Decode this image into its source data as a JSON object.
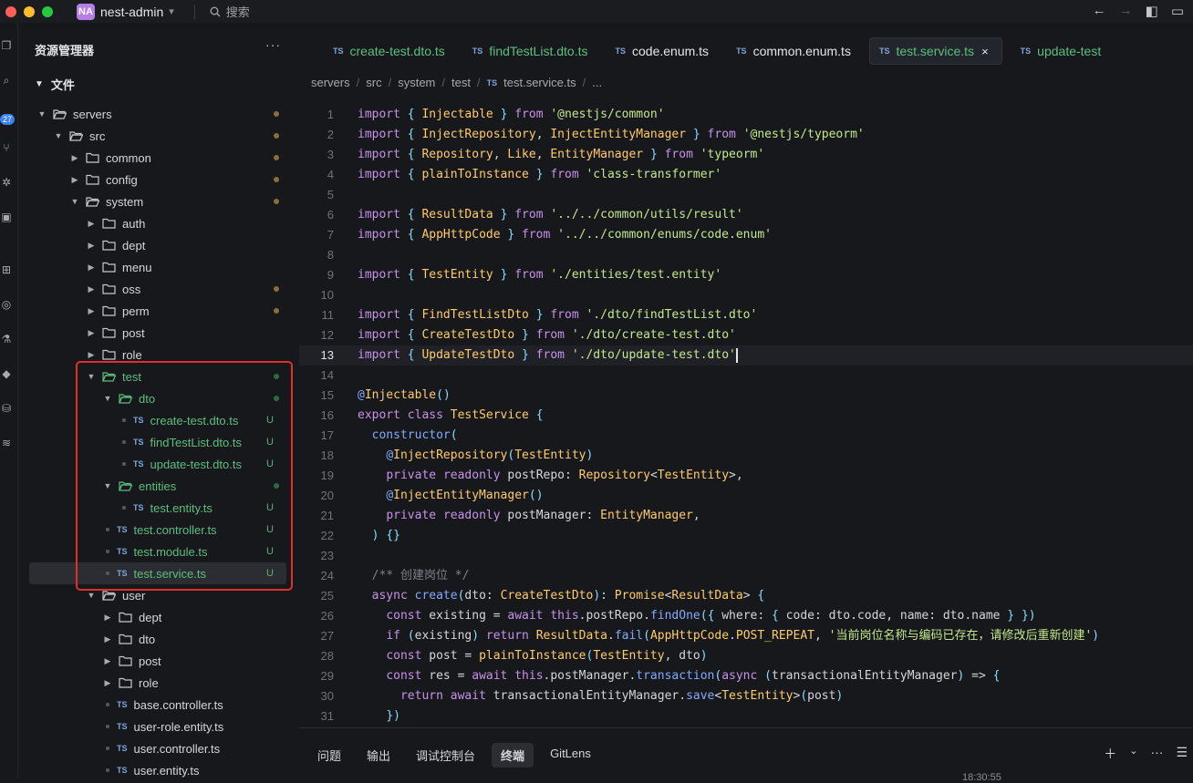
{
  "titlebar": {
    "workspace_badge": "NA",
    "workspace_name": "nest-admin",
    "search_label": "搜索"
  },
  "activity": {
    "badge_count": "27"
  },
  "explorer": {
    "title": "资源管理器",
    "more": "···",
    "section": "文件",
    "items": [
      {
        "label": "servers",
        "kind": "folder",
        "depth": 0,
        "open": true,
        "color": "folder",
        "status": "dot-modified"
      },
      {
        "label": "src",
        "kind": "folder",
        "depth": 1,
        "open": true,
        "color": "folder",
        "status": "dot-modified"
      },
      {
        "label": "common",
        "kind": "folder",
        "depth": 2,
        "open": false,
        "status": "dot-modified"
      },
      {
        "label": "config",
        "kind": "folder",
        "depth": 2,
        "open": false,
        "status": "dot-modified"
      },
      {
        "label": "system",
        "kind": "folder",
        "depth": 2,
        "open": true,
        "status": "dot-modified"
      },
      {
        "label": "auth",
        "kind": "folder",
        "depth": 3,
        "open": false
      },
      {
        "label": "dept",
        "kind": "folder",
        "depth": 3,
        "open": false
      },
      {
        "label": "menu",
        "kind": "folder",
        "depth": 3,
        "open": false
      },
      {
        "label": "oss",
        "kind": "folder",
        "depth": 3,
        "open": false,
        "status": "dot-modified"
      },
      {
        "label": "perm",
        "kind": "folder",
        "depth": 3,
        "open": false,
        "status": "dot-modified"
      },
      {
        "label": "post",
        "kind": "folder",
        "depth": 3,
        "open": false
      },
      {
        "label": "role",
        "kind": "folder",
        "depth": 3,
        "open": false
      },
      {
        "label": "test",
        "kind": "folder",
        "depth": 3,
        "open": true,
        "green": true,
        "status": "dot-new"
      },
      {
        "label": "dto",
        "kind": "folder",
        "depth": 4,
        "open": true,
        "green": true,
        "status": "dot-new"
      },
      {
        "label": "create-test.dto.ts",
        "kind": "ts",
        "depth": 5,
        "green": true,
        "status": "U"
      },
      {
        "label": "findTestList.dto.ts",
        "kind": "ts",
        "depth": 5,
        "green": true,
        "status": "U"
      },
      {
        "label": "update-test.dto.ts",
        "kind": "ts",
        "depth": 5,
        "green": true,
        "status": "U"
      },
      {
        "label": "entities",
        "kind": "folder",
        "depth": 4,
        "open": true,
        "green": true,
        "status": "dot-new"
      },
      {
        "label": "test.entity.ts",
        "kind": "ts",
        "depth": 5,
        "green": true,
        "status": "U"
      },
      {
        "label": "test.controller.ts",
        "kind": "ts",
        "depth": 4,
        "green": true,
        "status": "U"
      },
      {
        "label": "test.module.ts",
        "kind": "ts",
        "depth": 4,
        "green": true,
        "status": "U"
      },
      {
        "label": "test.service.ts",
        "kind": "ts",
        "depth": 4,
        "green": true,
        "status": "U",
        "selected": true
      },
      {
        "label": "user",
        "kind": "folder",
        "depth": 3,
        "open": true
      },
      {
        "label": "dept",
        "kind": "folder",
        "depth": 4,
        "open": false
      },
      {
        "label": "dto",
        "kind": "folder",
        "depth": 4,
        "open": false
      },
      {
        "label": "post",
        "kind": "folder",
        "depth": 4,
        "open": false
      },
      {
        "label": "role",
        "kind": "folder",
        "depth": 4,
        "open": false
      },
      {
        "label": "base.controller.ts",
        "kind": "ts",
        "depth": 4
      },
      {
        "label": "user-role.entity.ts",
        "kind": "ts",
        "depth": 4
      },
      {
        "label": "user.controller.ts",
        "kind": "ts",
        "depth": 4
      },
      {
        "label": "user.entity.ts",
        "kind": "ts",
        "depth": 4
      }
    ]
  },
  "tabs": [
    {
      "label": "create-test.dto.ts",
      "green": true
    },
    {
      "label": "findTestList.dto.ts",
      "green": true
    },
    {
      "label": "code.enum.ts",
      "green": false
    },
    {
      "label": "common.enum.ts",
      "green": false
    },
    {
      "label": "test.service.ts",
      "green": true,
      "active": true
    },
    {
      "label": "update-test",
      "green": true
    }
  ],
  "ts_badge": "TS",
  "close_glyph": "×",
  "breadcrumb": [
    "servers",
    "src",
    "system",
    "test",
    "test.service.ts",
    "..."
  ],
  "code_lines": [
    "import { Injectable } from '@nestjs/common'",
    "import { InjectRepository, InjectEntityManager } from '@nestjs/typeorm'",
    "import { Repository, Like, EntityManager } from 'typeorm'",
    "import { plainToInstance } from 'class-transformer'",
    "",
    "import { ResultData } from '../../common/utils/result'",
    "import { AppHttpCode } from '../../common/enums/code.enum'",
    "",
    "import { TestEntity } from './entities/test.entity'",
    "",
    "import { FindTestListDto } from './dto/findTestList.dto'",
    "import { CreateTestDto } from './dto/create-test.dto'",
    "import { UpdateTestDto } from './dto/update-test.dto'",
    "",
    "@Injectable()",
    "export class TestService {",
    "  constructor(",
    "    @InjectRepository(TestEntity)",
    "    private readonly postRepo: Repository<TestEntity>,",
    "    @InjectEntityManager()",
    "    private readonly postManager: EntityManager,",
    "  ) {}",
    "",
    "  /** 创建岗位 */",
    "  async create(dto: CreateTestDto): Promise<ResultData> {",
    "    const existing = await this.postRepo.findOne({ where: { code: dto.code, name: dto.name } })",
    "    if (existing) return ResultData.fail(AppHttpCode.POST_REPEAT, '当前岗位名称与编码已存在，请修改后重新创建')",
    "    const post = plainToInstance(TestEntity, dto)",
    "    const res = await this.postManager.transaction(async (transactionalEntityManager) => {",
    "      return await transactionalEntityManager.save<TestEntity>(post)",
    "    })"
  ],
  "current_line": 13,
  "panel": {
    "tabs": [
      "问题",
      "输出",
      "调试控制台",
      "终端",
      "GitLens"
    ],
    "active": "终端",
    "timestamp": "18:30:55"
  },
  "colors": {
    "accent": "#3b82f6",
    "untracked": "#5cbf7f",
    "modified_dot": "#8b6d3f",
    "highlight_box": "#e0302b"
  }
}
